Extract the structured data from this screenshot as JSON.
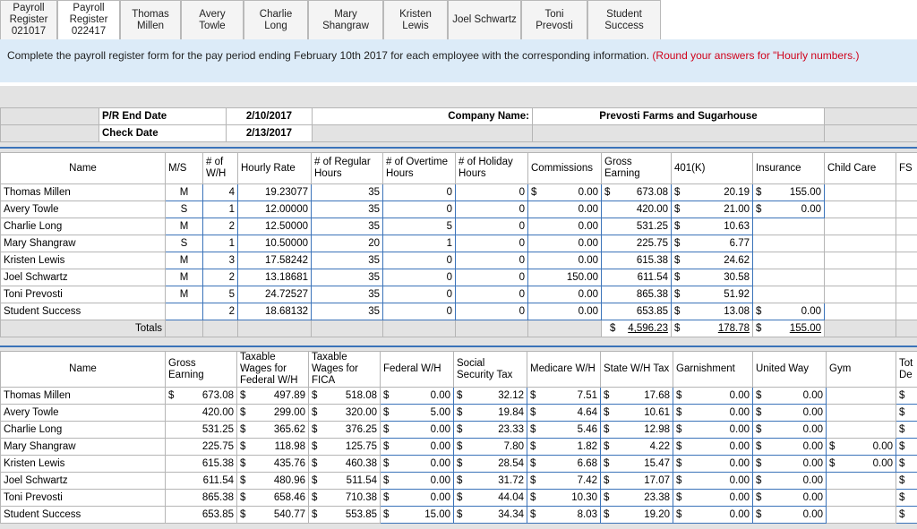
{
  "tabs": [
    {
      "label": "Payroll Register 021017",
      "lines": [
        "Payroll",
        "Register",
        "021017"
      ],
      "active": false
    },
    {
      "label": "Payroll Register 022417",
      "lines": [
        "Payroll",
        "Register",
        "022417"
      ],
      "active": true
    },
    {
      "label": "Thomas Millen",
      "lines": [
        "Thomas",
        "Millen"
      ],
      "active": false
    },
    {
      "label": "Avery Towle",
      "lines": [
        "Avery Towle"
      ],
      "active": false
    },
    {
      "label": "Charlie Long",
      "lines": [
        "Charlie Long"
      ],
      "active": false
    },
    {
      "label": "Mary Shangraw",
      "lines": [
        "Mary",
        "Shangraw"
      ],
      "active": false
    },
    {
      "label": "Kristen Lewis",
      "lines": [
        "Kristen",
        "Lewis"
      ],
      "active": false
    },
    {
      "label": "Joel Schwartz",
      "lines": [
        "Joel",
        "Schwartz"
      ],
      "active": false
    },
    {
      "label": "Toni Prevosti",
      "lines": [
        "Toni Prevosti"
      ],
      "active": false
    },
    {
      "label": "Student Success",
      "lines": [
        "Student",
        "Success"
      ],
      "active": false
    }
  ],
  "instruction": {
    "text": "Complete the payroll register form for the pay period ending February 10th 2017 for each employee with the corresponding information.",
    "note": "(Round your answers for \"Hourly numbers.)"
  },
  "header_info": {
    "pr_end_label": "P/R End Date",
    "pr_end_value": "2/10/2017",
    "check_label": "Check Date",
    "check_value": "2/13/2017",
    "company_label": "Company Name:",
    "company_value": "Prevosti Farms and Sugarhouse"
  },
  "table1": {
    "headers": [
      "Name",
      "M/S",
      "# of W/H",
      "Hourly Rate",
      "# of Regular Hours",
      "# of Overtime Hours",
      "# of Holiday Hours",
      "Commissions",
      "Gross Earning",
      "401(K)",
      "Insurance",
      "Child Care",
      "FS"
    ],
    "rows": [
      {
        "name": "Thomas Millen",
        "ms": "M",
        "wh": "4",
        "rate": "19.23077",
        "reg": "35",
        "ot": "0",
        "hol": "0",
        "comm_d": "$",
        "comm": "0.00",
        "gross_d": "$",
        "gross": "673.08",
        "k_d": "$",
        "k": "20.19",
        "ins_d": "$",
        "ins": "155.00"
      },
      {
        "name": "Avery Towle",
        "ms": "S",
        "wh": "1",
        "rate": "12.00000",
        "reg": "35",
        "ot": "0",
        "hol": "0",
        "comm_d": "",
        "comm": "0.00",
        "gross_d": "",
        "gross": "420.00",
        "k_d": "$",
        "k": "21.00",
        "ins_d": "$",
        "ins": "0.00"
      },
      {
        "name": "Charlie Long",
        "ms": "M",
        "wh": "2",
        "rate": "12.50000",
        "reg": "35",
        "ot": "5",
        "hol": "0",
        "comm_d": "",
        "comm": "0.00",
        "gross_d": "",
        "gross": "531.25",
        "k_d": "$",
        "k": "10.63",
        "ins_d": "",
        "ins": ""
      },
      {
        "name": "Mary Shangraw",
        "ms": "S",
        "wh": "1",
        "rate": "10.50000",
        "reg": "20",
        "ot": "1",
        "hol": "0",
        "comm_d": "",
        "comm": "0.00",
        "gross_d": "",
        "gross": "225.75",
        "k_d": "$",
        "k": "6.77",
        "ins_d": "",
        "ins": ""
      },
      {
        "name": "Kristen Lewis",
        "ms": "M",
        "wh": "3",
        "rate": "17.58242",
        "reg": "35",
        "ot": "0",
        "hol": "0",
        "comm_d": "",
        "comm": "0.00",
        "gross_d": "",
        "gross": "615.38",
        "k_d": "$",
        "k": "24.62",
        "ins_d": "",
        "ins": ""
      },
      {
        "name": "Joel Schwartz",
        "ms": "M",
        "wh": "2",
        "rate": "13.18681",
        "reg": "35",
        "ot": "0",
        "hol": "0",
        "comm_d": "",
        "comm": "150.00",
        "gross_d": "",
        "gross": "611.54",
        "k_d": "$",
        "k": "30.58",
        "ins_d": "",
        "ins": ""
      },
      {
        "name": "Toni Prevosti",
        "ms": "M",
        "wh": "5",
        "rate": "24.72527",
        "reg": "35",
        "ot": "0",
        "hol": "0",
        "comm_d": "",
        "comm": "0.00",
        "gross_d": "",
        "gross": "865.38",
        "k_d": "$",
        "k": "51.92",
        "ins_d": "",
        "ins": ""
      },
      {
        "name": "Student Success",
        "ms": "",
        "wh": "2",
        "rate": "18.68132",
        "reg": "35",
        "ot": "0",
        "hol": "0",
        "comm_d": "",
        "comm": "0.00",
        "gross_d": "",
        "gross": "653.85",
        "k_d": "$",
        "k": "13.08",
        "ins_d": "$",
        "ins": "0.00"
      }
    ],
    "totals_label": "Totals",
    "totals": {
      "gross_d": "$",
      "gross": "4,596.23",
      "k_d": "$",
      "k": "178.78",
      "ins_d": "$",
      "ins": "155.00"
    }
  },
  "table2": {
    "headers": [
      "Name",
      "Gross Earning",
      "Taxable Wages for Federal W/H",
      "Taxable Wages for FICA",
      "Federal W/H",
      "Social Security Tax",
      "Medicare W/H",
      "State W/H Tax",
      "Garnishment",
      "United Way",
      "Gym",
      "Tot De"
    ],
    "rows": [
      {
        "name": "Thomas Millen",
        "gross": "673.08",
        "fed_tw": "497.89",
        "fica_tw": "518.08",
        "fwh": "0.00",
        "ss": "32.12",
        "med": "7.51",
        "state": "17.68",
        "garn": "0.00",
        "uw": "0.00",
        "gym_d": "",
        "gym": ""
      },
      {
        "name": "Avery Towle",
        "gross": "420.00",
        "fed_tw": "299.00",
        "fica_tw": "320.00",
        "fwh": "5.00",
        "ss": "19.84",
        "med": "4.64",
        "state": "10.61",
        "garn": "0.00",
        "uw": "0.00",
        "gym_d": "",
        "gym": ""
      },
      {
        "name": "Charlie Long",
        "gross": "531.25",
        "fed_tw": "365.62",
        "fica_tw": "376.25",
        "fwh": "0.00",
        "ss": "23.33",
        "med": "5.46",
        "state": "12.98",
        "garn": "0.00",
        "uw": "0.00",
        "gym_d": "",
        "gym": ""
      },
      {
        "name": "Mary Shangraw",
        "gross": "225.75",
        "fed_tw": "118.98",
        "fica_tw": "125.75",
        "fwh": "0.00",
        "ss": "7.80",
        "med": "1.82",
        "state": "4.22",
        "garn": "0.00",
        "uw": "0.00",
        "gym_d": "$",
        "gym": "0.00"
      },
      {
        "name": "Kristen Lewis",
        "gross": "615.38",
        "fed_tw": "435.76",
        "fica_tw": "460.38",
        "fwh": "0.00",
        "ss": "28.54",
        "med": "6.68",
        "state": "15.47",
        "garn": "0.00",
        "uw": "0.00",
        "gym_d": "$",
        "gym": "0.00"
      },
      {
        "name": "Joel Schwartz",
        "gross": "611.54",
        "fed_tw": "480.96",
        "fica_tw": "511.54",
        "fwh": "0.00",
        "ss": "31.72",
        "med": "7.42",
        "state": "17.07",
        "garn": "0.00",
        "uw": "0.00",
        "gym_d": "",
        "gym": ""
      },
      {
        "name": "Toni Prevosti",
        "gross": "865.38",
        "fed_tw": "658.46",
        "fica_tw": "710.38",
        "fwh": "0.00",
        "ss": "44.04",
        "med": "10.30",
        "state": "23.38",
        "garn": "0.00",
        "uw": "0.00",
        "gym_d": "",
        "gym": ""
      },
      {
        "name": "Student Success",
        "gross": "653.85",
        "fed_tw": "540.77",
        "fica_tw": "553.85",
        "fwh": "15.00",
        "ss": "34.34",
        "med": "8.03",
        "state": "19.20",
        "garn": "0.00",
        "uw": "0.00",
        "gym_d": "",
        "gym": ""
      }
    ],
    "currency": "$"
  },
  "colors": {
    "accent": "#3b73b9",
    "instr_bg": "#dcebf8",
    "note": "#d0021b",
    "sheet_bg": "#e3e3e3"
  }
}
